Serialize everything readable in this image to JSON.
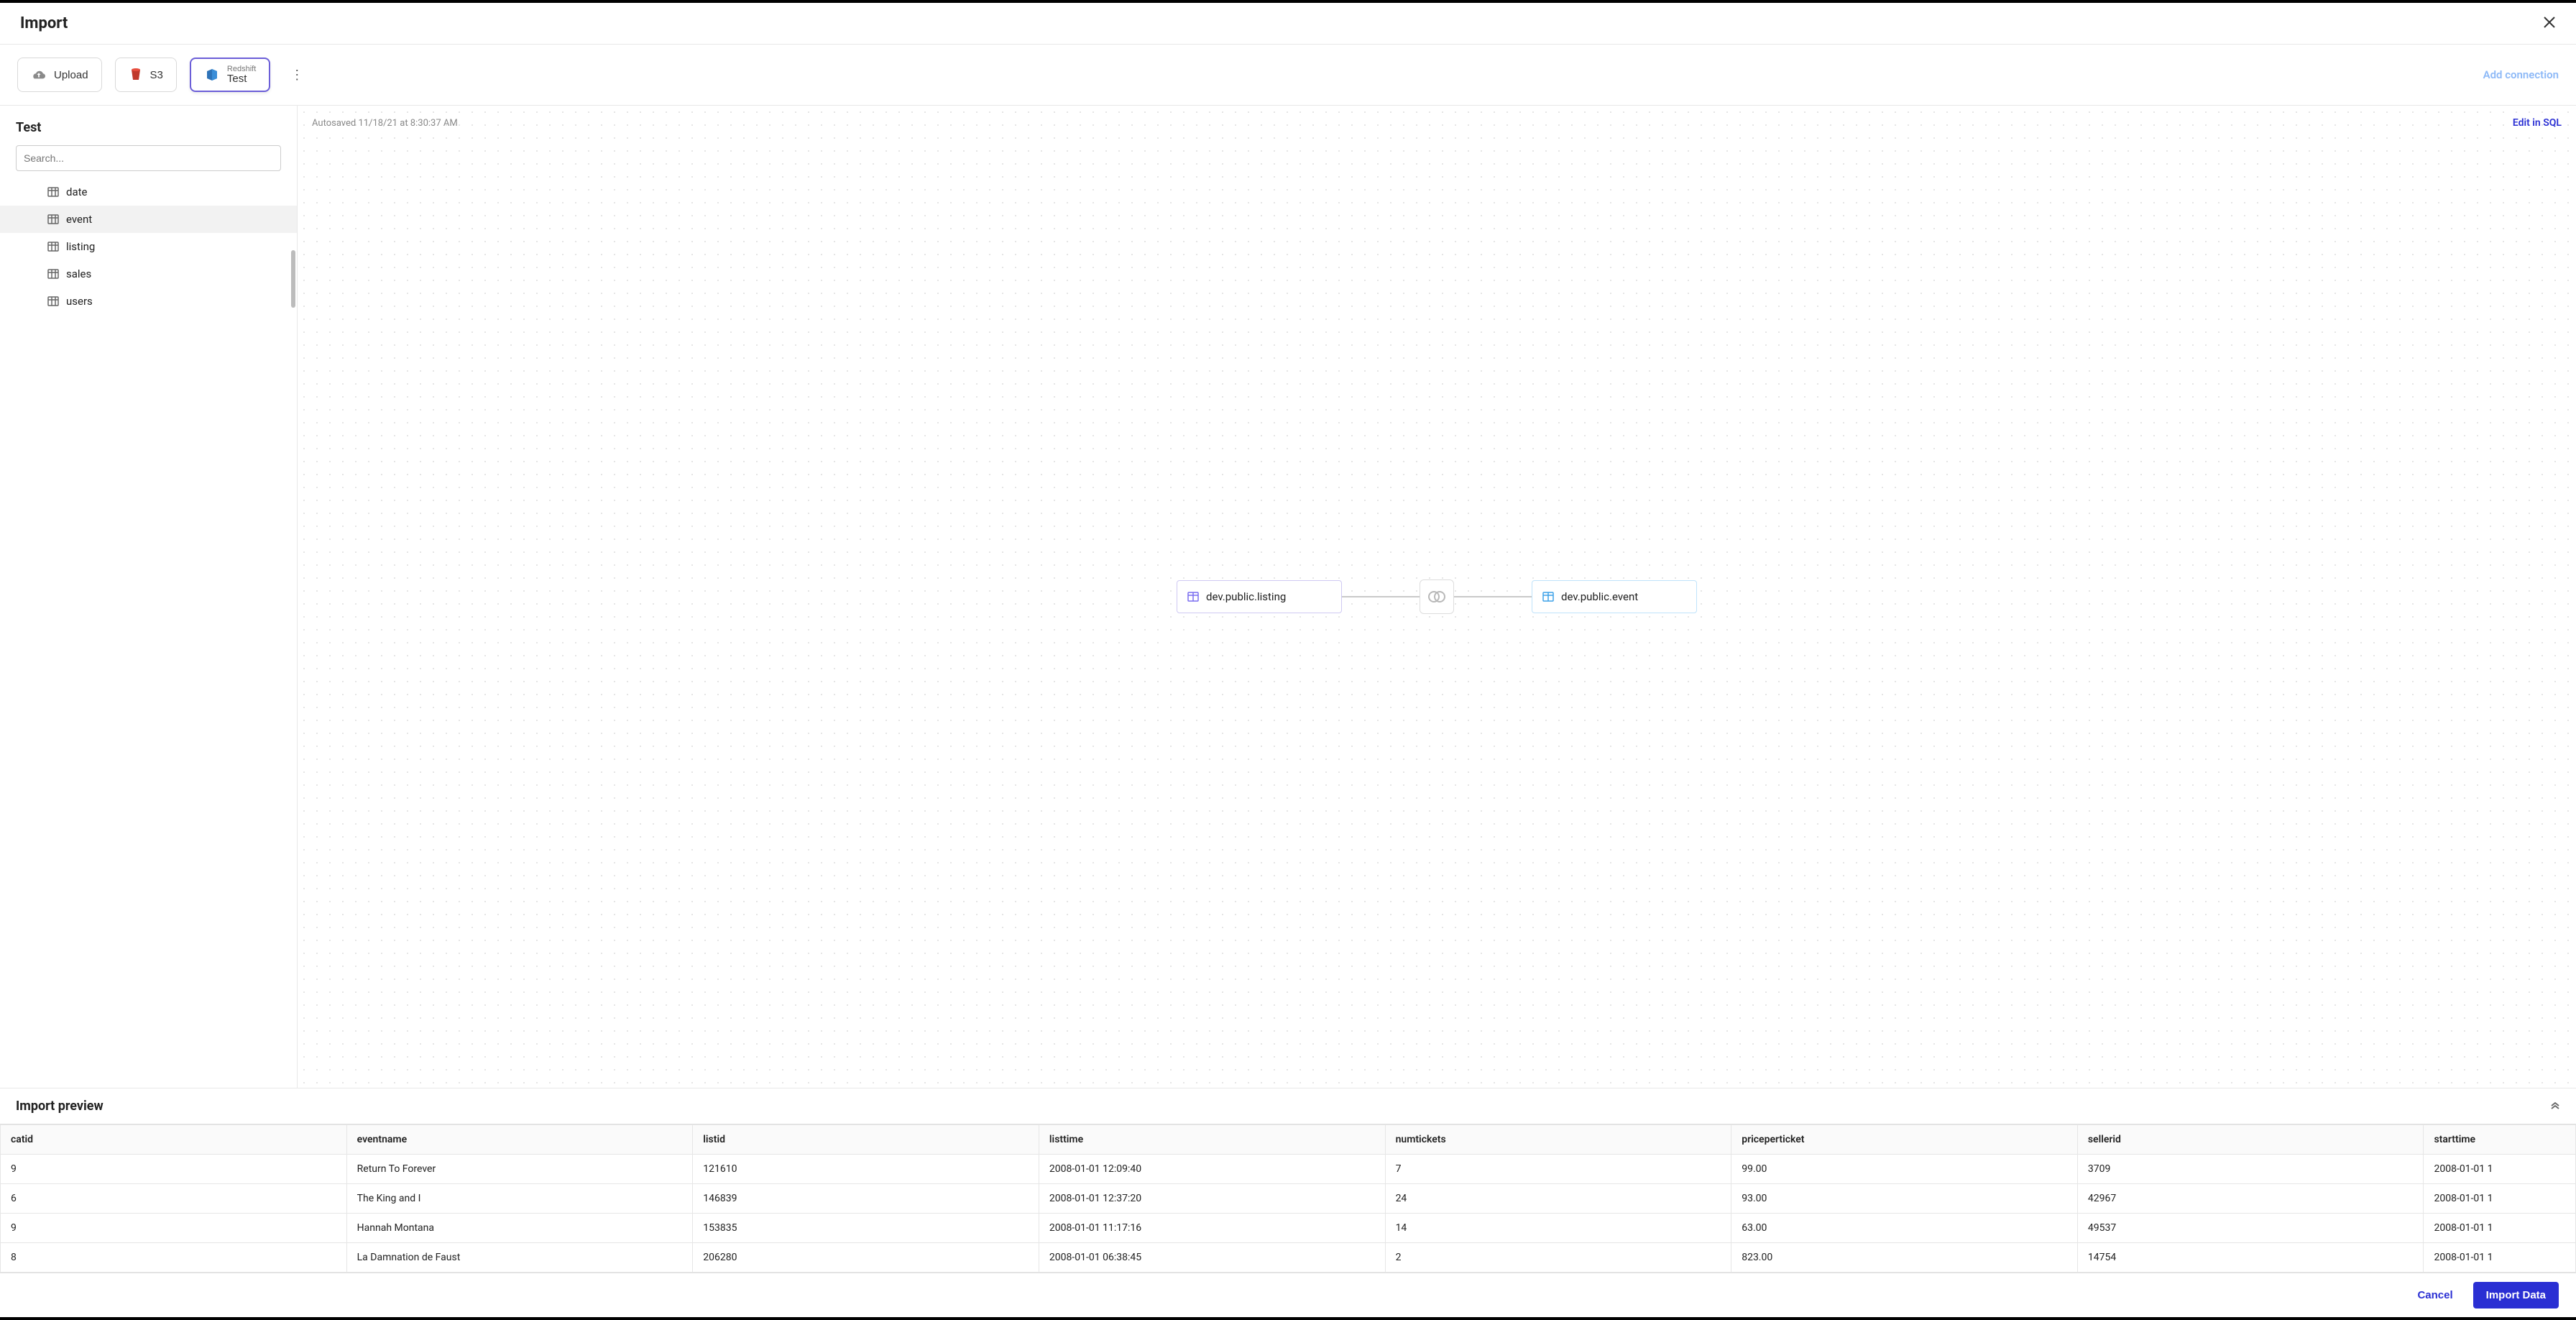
{
  "header": {
    "title": "Import"
  },
  "connections": {
    "upload_label": "Upload",
    "s3_label": "S3",
    "redshift_sub": "Redshift",
    "redshift_name": "Test",
    "add_label": "Add connection"
  },
  "sidebar": {
    "title": "Test",
    "search_placeholder": "Search...",
    "items": [
      {
        "label": "date"
      },
      {
        "label": "event"
      },
      {
        "label": "listing"
      },
      {
        "label": "sales"
      },
      {
        "label": "users"
      }
    ],
    "selected_index": 1
  },
  "canvas": {
    "autosave": "Autosaved 11/18/21 at 8:30:37 AM",
    "edit_sql": "Edit in SQL",
    "left_node": "dev.public.listing",
    "right_node": "dev.public.event"
  },
  "preview": {
    "title": "Import preview",
    "columns": [
      "catid",
      "eventname",
      "listid",
      "listtime",
      "numtickets",
      "priceperticket",
      "sellerid",
      "starttime"
    ],
    "rows": [
      [
        "9",
        "Return To Forever",
        "121610",
        "2008-01-01 12:09:40",
        "7",
        "99.00",
        "3709",
        "2008-01-01 1"
      ],
      [
        "6",
        "The King and I",
        "146839",
        "2008-01-01 12:37:20",
        "24",
        "93.00",
        "42967",
        "2008-01-01 1"
      ],
      [
        "9",
        "Hannah Montana",
        "153835",
        "2008-01-01 11:17:16",
        "14",
        "63.00",
        "49537",
        "2008-01-01 1"
      ],
      [
        "8",
        "La Damnation de Faust",
        "206280",
        "2008-01-01 06:38:45",
        "2",
        "823.00",
        "14754",
        "2008-01-01 1"
      ]
    ]
  },
  "footer": {
    "cancel": "Cancel",
    "import": "Import Data"
  }
}
